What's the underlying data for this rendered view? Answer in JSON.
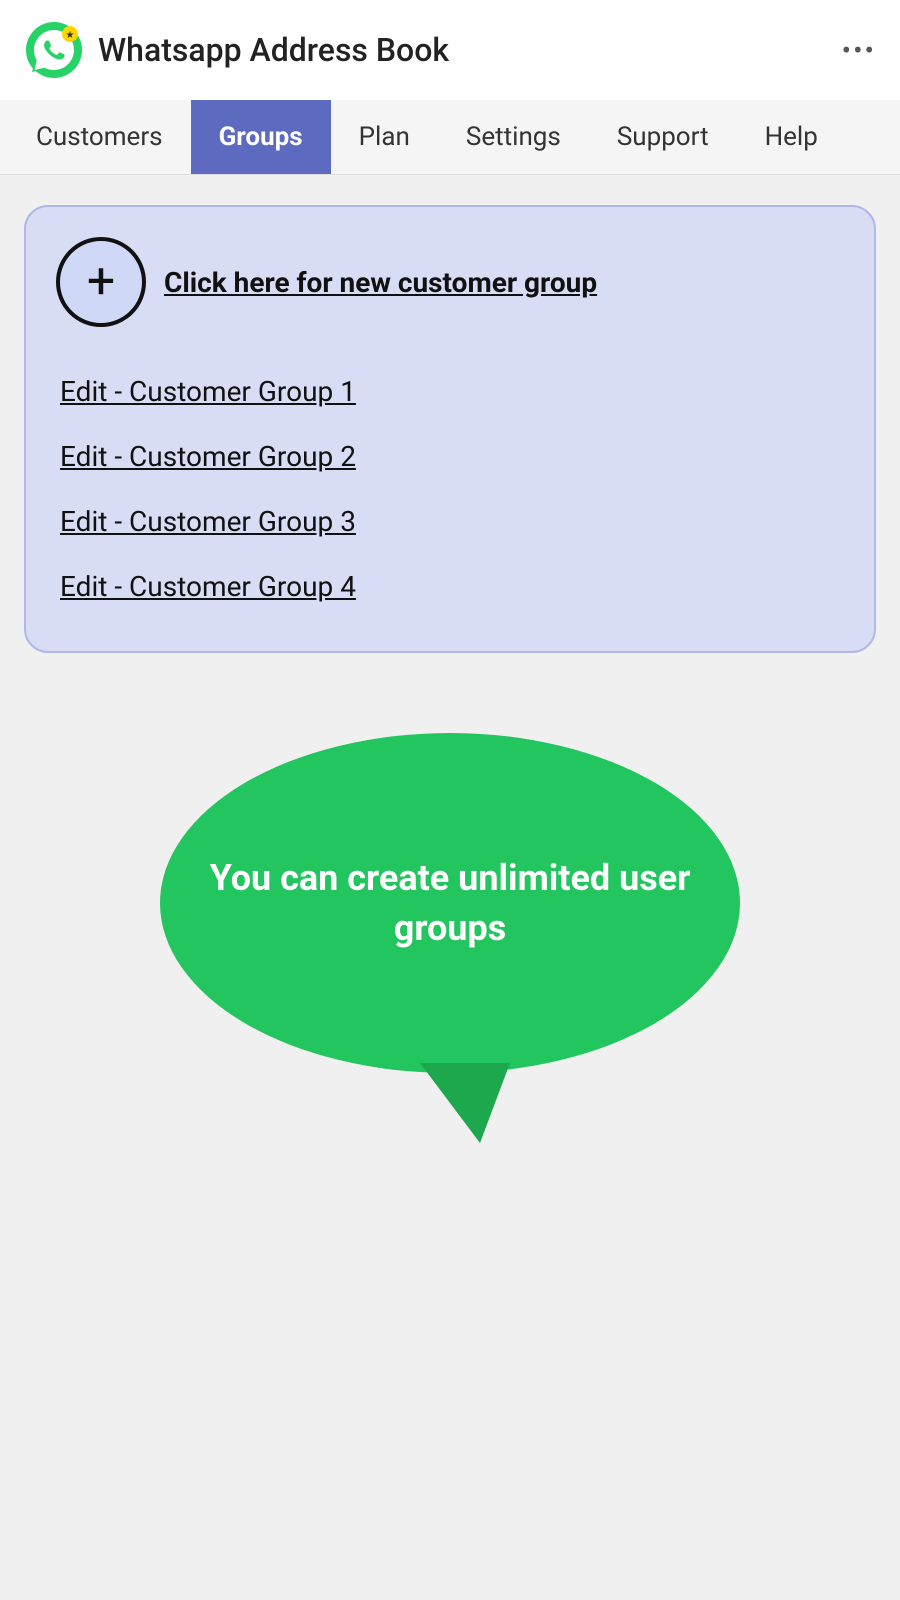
{
  "header": {
    "app_title": "Whatsapp Address Book",
    "menu_dots": "•••"
  },
  "nav": {
    "items": [
      {
        "id": "customers",
        "label": "Customers",
        "active": false
      },
      {
        "id": "groups",
        "label": "Groups",
        "active": true
      },
      {
        "id": "plan",
        "label": "Plan",
        "active": false
      },
      {
        "id": "settings",
        "label": "Settings",
        "active": false
      },
      {
        "id": "support",
        "label": "Support",
        "active": false
      },
      {
        "id": "help",
        "label": "Help",
        "active": false
      }
    ]
  },
  "groups": {
    "new_group_label": "Click here for new customer group",
    "group_links": [
      "Edit - Customer Group 1",
      "Edit - Customer Group 2",
      "Edit - Customer Group 3",
      "Edit - Customer Group 4"
    ]
  },
  "bubble": {
    "text": "You can create unlimited user groups"
  }
}
